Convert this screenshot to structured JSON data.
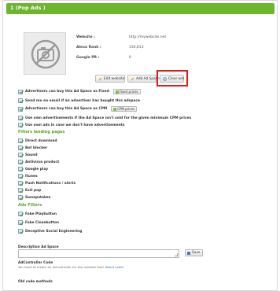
{
  "panel": {
    "title": "1 (Pop Ads )"
  },
  "site": {
    "rows": [
      {
        "label": "Website :",
        "value": "http://mywebsite.net"
      },
      {
        "label": "Alexa Rank :",
        "value": "334,813"
      },
      {
        "label": "Google PR :",
        "value": "0"
      }
    ]
  },
  "actions": {
    "edit_website": "Edit website",
    "add_ad_space": "Add Ad Space",
    "clear_ads": "Clear ads"
  },
  "options": [
    {
      "label": "Advertisers can buy this Ad Space as Fixed",
      "button": "Fixed prices"
    },
    {
      "label": "Send me an email if an advertiser has bought this adspace"
    },
    {
      "label": "Advertisers can buy this Ad Space as CPM",
      "button": "CPM prices"
    },
    {
      "label": "Use own advertisements if the Ad Space isn't sold for the given minimum CPM prices"
    },
    {
      "label": "Use own ads in case we don't have advertisements"
    }
  ],
  "filters": {
    "title": "Filters landing pages",
    "items": [
      "Direct download",
      "Bot blocker",
      "Sound",
      "Antivirus product",
      "Google play",
      "Itunes",
      "Push Notifications / alerts",
      "Exit pop",
      "Sweepstakes"
    ]
  },
  "ads_filters": {
    "title": "Ads Filters",
    "items": [
      "Fake Playbutton",
      "Fake Closebutton",
      "Deceptive Social Engineering"
    ]
  },
  "description": {
    "label": "Description Ad Space",
    "value": "",
    "save": "Save"
  },
  "adcontroller": {
    "title": "AdController Code",
    "text": "You have to create an AdController for this website first!",
    "link": "About code!"
  },
  "old_code": {
    "title": "Old code methods"
  },
  "colors": {
    "accent": "#6cb52d",
    "highlight": "#d8201e"
  }
}
